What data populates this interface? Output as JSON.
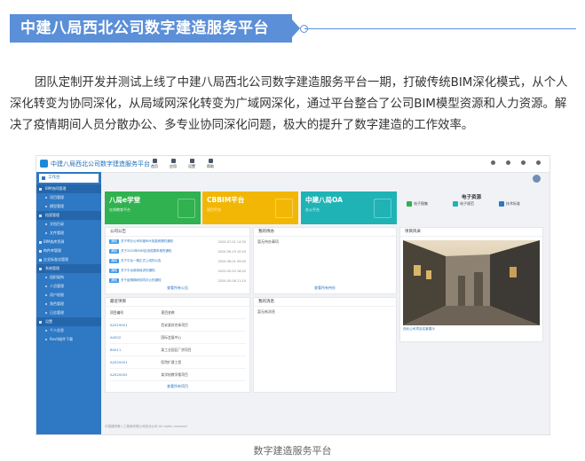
{
  "heading": "中建八局西北公司数字建造服务平台",
  "paragraph": "团队定制开发并测试上线了中建八局西北公司数字建造服务平台一期，打破传统BIM深化模式，从个人深化转变为协同深化，从局域网深化转变为广域网深化，通过平台整合了公司BIM模型资源和人力资源。解决了疫情期间人员分散办公、多专业协同深化问题，极大的提升了数字建造的工作效率。",
  "caption": "数字建造服务平台",
  "colors": {
    "accent": "#5b8fd8",
    "sidebar": "#2e78c4",
    "tile_green": "#2fb24f",
    "tile_yellow": "#f2b705",
    "tile_teal": "#1fb3b6"
  },
  "screenshot": {
    "app_title": "中建八局西北公司数字建造服务平台",
    "top_nav": [
      "首页",
      "应用",
      "设置",
      "帮助"
    ],
    "sidebar": {
      "head": "工作台",
      "items": [
        {
          "label": "BIM协同管理",
          "type": "group"
        },
        {
          "label": "项目管理",
          "type": "sub"
        },
        {
          "label": "模型管理",
          "type": "sub"
        },
        {
          "label": "档案管理",
          "type": "group"
        },
        {
          "label": "文档目录",
          "type": "sub"
        },
        {
          "label": "文件管理",
          "type": "sub"
        },
        {
          "label": "BIM族库资源",
          "type": "item"
        },
        {
          "label": "构件库管理",
          "type": "item"
        },
        {
          "label": "企业标准化管理",
          "type": "item"
        },
        {
          "label": "系统管理",
          "type": "group"
        },
        {
          "label": "组织架构",
          "type": "sub"
        },
        {
          "label": "人员管理",
          "type": "sub"
        },
        {
          "label": "用户权限",
          "type": "sub"
        },
        {
          "label": "角色管理",
          "type": "sub"
        },
        {
          "label": "日志管理",
          "type": "sub"
        },
        {
          "label": "设置",
          "type": "group"
        },
        {
          "label": "个人信息",
          "type": "sub"
        },
        {
          "label": "Revit插件下载",
          "type": "sub"
        }
      ]
    },
    "tiles": [
      {
        "title": "八局e学堂",
        "sub": "在线教育平台"
      },
      {
        "title": "CBBIM平台",
        "sub": "项目平台"
      },
      {
        "title": "中建八局OA",
        "sub": "办公平台"
      }
    ],
    "notices": {
      "title": "公司公告",
      "tag": "通知",
      "rows": [
        {
          "text": "关于举办公司年度BIM技能竞赛的通知",
          "date": "2020-07-01 14:30"
        },
        {
          "text": "关于2020年BIM应用成果申报的通知",
          "date": "2020-06-15 10:20"
        },
        {
          "text": "关于平台一期正式上线的公告",
          "date": "2020-06-01 09:00"
        },
        {
          "text": "关于平台使用培训的通知",
          "date": "2020-05-20 16:45"
        },
        {
          "text": "关于疫情期间协同办公的通知",
          "date": "2020-05-08 11:10"
        }
      ],
      "more": "查看所有公告"
    },
    "todos": {
      "title": "我的待办",
      "rows": [
        "暂无待办事项"
      ],
      "more": "查看所有待办"
    },
    "projects": {
      "title": "最近项目",
      "columns": [
        "项目编号",
        "项目名称"
      ],
      "rows": [
        {
          "code": "A2019001",
          "name": "西安某综合体项目"
        },
        {
          "code": "A0002",
          "name": "国际会展中心"
        },
        {
          "code": "B0011",
          "name": "某工业园区厂房项目"
        },
        {
          "code": "A2020001",
          "name": "医院扩建工程"
        },
        {
          "code": "A2020002",
          "name": "某学校教学楼项目"
        }
      ],
      "more": "查看所有项目"
    },
    "messages": {
      "title": "我的消息",
      "rows": [
        "暂无新消息"
      ]
    },
    "resources": {
      "title": "电子资源",
      "buttons": [
        {
          "label": "电子图集",
          "color": "#2fb24f"
        },
        {
          "label": "电子规范",
          "color": "#1fb3b6"
        },
        {
          "label": "技术标准",
          "color": "#2e78c4"
        }
      ],
      "photo_head": "项目风采",
      "photo_caption": "西北公司项目实景展示"
    },
    "footer": "中国建筑第八工程局有限公司西北公司 All rights reserved"
  }
}
